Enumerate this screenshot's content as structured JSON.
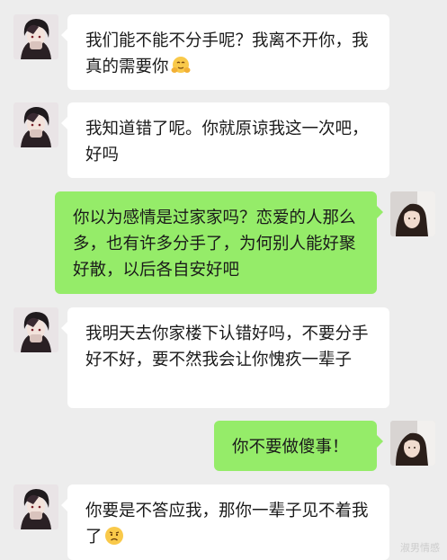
{
  "messages": [
    {
      "side": "in",
      "text": "我们能不能不分手呢？我离不开你，我真的需要你",
      "emoji": "hug-face-emoji"
    },
    {
      "side": "in",
      "text": "我知道错了呢。你就原谅我这一次吧，好吗"
    },
    {
      "side": "out",
      "text": "你以为感情是过家家吗？恋爱的人那么多，也有许多分手了，为何别人能好聚好散，以后各自安好吧"
    },
    {
      "side": "in",
      "text": "我明天去你家楼下认错好吗，不要分手好不好，要不然我会让你愧疚一辈子"
    },
    {
      "side": "out",
      "text": "你不要做傻事！"
    },
    {
      "side": "in",
      "text": "你要是不答应我，那你一辈子见不着我了",
      "emoji": "sad-face-emoji"
    }
  ],
  "watermark": "淑男情感",
  "colors": {
    "background": "#ededed",
    "incoming_bubble": "#ffffff",
    "outgoing_bubble": "#95ec69"
  }
}
